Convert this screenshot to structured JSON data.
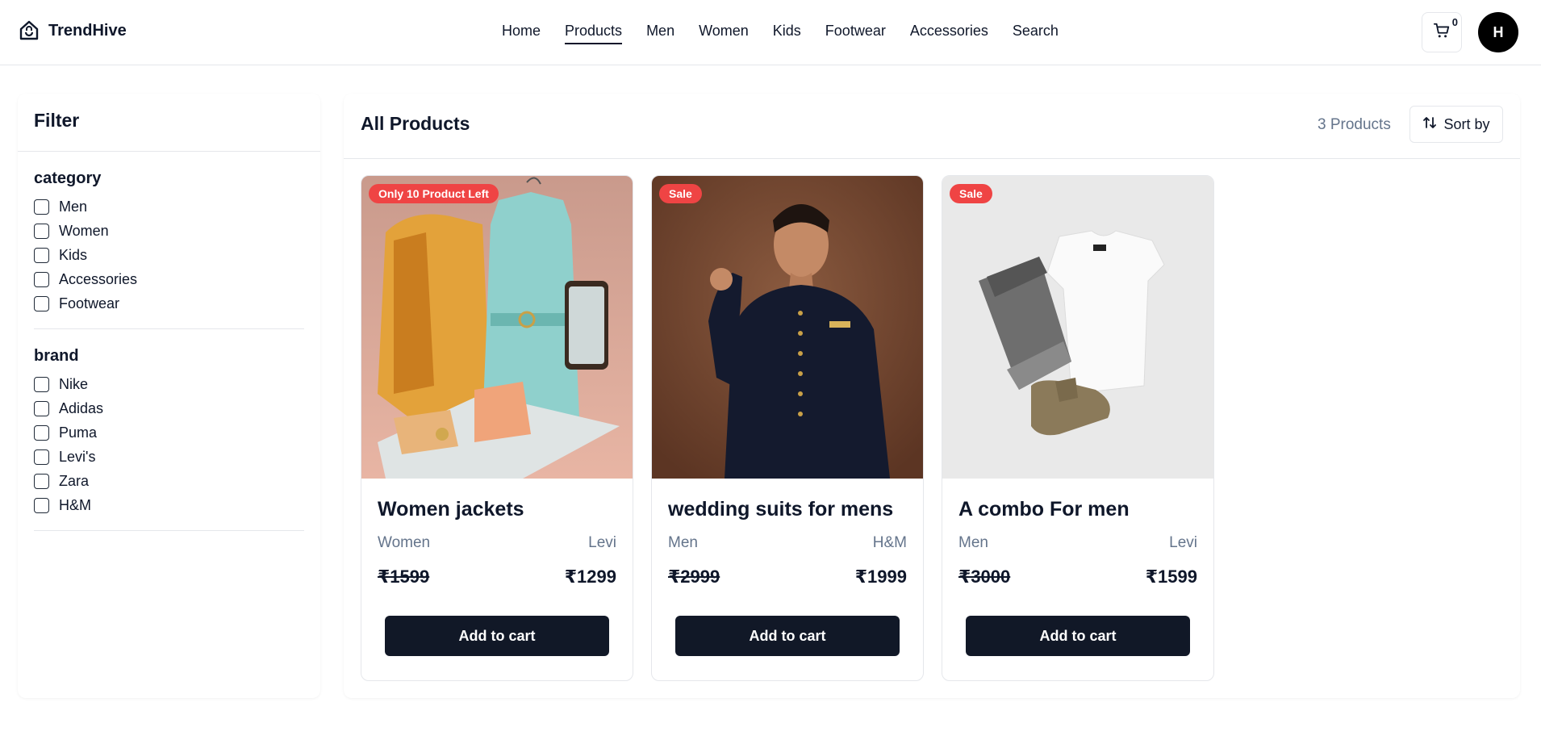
{
  "header": {
    "brand": "TrendHive",
    "nav": [
      {
        "label": "Home",
        "active": false
      },
      {
        "label": "Products",
        "active": true
      },
      {
        "label": "Men",
        "active": false
      },
      {
        "label": "Women",
        "active": false
      },
      {
        "label": "Kids",
        "active": false
      },
      {
        "label": "Footwear",
        "active": false
      },
      {
        "label": "Accessories",
        "active": false
      },
      {
        "label": "Search",
        "active": false
      }
    ],
    "cart_count": "0",
    "avatar_initial": "H"
  },
  "sidebar": {
    "title": "Filter",
    "sections": [
      {
        "title": "category",
        "options": [
          "Men",
          "Women",
          "Kids",
          "Accessories",
          "Footwear"
        ]
      },
      {
        "title": "brand",
        "options": [
          "Nike",
          "Adidas",
          "Puma",
          "Levi's",
          "Zara",
          "H&M"
        ]
      }
    ]
  },
  "main": {
    "title": "All Products",
    "count_label": "3 Products",
    "sort_label": "Sort by"
  },
  "products": [
    {
      "badge": "Only 10 Product Left",
      "title": "Women jackets",
      "category": "Women",
      "brand": "Levi",
      "old_price": "₹1599",
      "price": "₹1299",
      "button": "Add to cart"
    },
    {
      "badge": "Sale",
      "title": "wedding suits for mens",
      "category": "Men",
      "brand": "H&M",
      "old_price": "₹2999",
      "price": "₹1999",
      "button": "Add to cart"
    },
    {
      "badge": "Sale",
      "title": "A combo For men",
      "category": "Men",
      "brand": "Levi",
      "old_price": "₹3000",
      "price": "₹1599",
      "button": "Add to cart"
    }
  ],
  "colors": {
    "badge": "#ef4444",
    "button": "#111827",
    "muted": "#64748b"
  }
}
